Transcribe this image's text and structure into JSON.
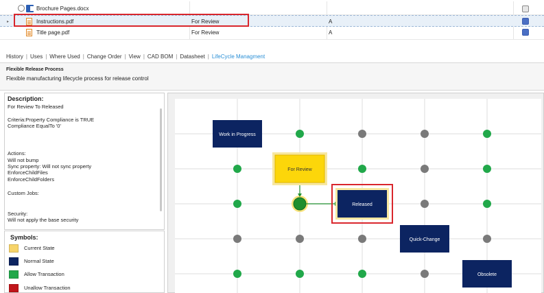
{
  "files": [
    {
      "name": "Brochure Pages.docx",
      "status": "",
      "revision": ""
    },
    {
      "name": "Instructions.pdf",
      "status": "For Review",
      "revision": "A"
    },
    {
      "name": "Title page.pdf",
      "status": "For Review",
      "revision": "A"
    }
  ],
  "tabs": [
    "History",
    "Uses",
    "Where Used",
    "Change Order",
    "View",
    "CAD BOM",
    "Datasheet",
    "LifeCycle Managment"
  ],
  "lifecycle": {
    "title": "Flexible Release Process",
    "description": "Flexible manufacturing lifecycle process for release control"
  },
  "details": {
    "heading": "Description:",
    "lines": [
      "For Review To Released",
      "Criteria:Property Compliance is TRUE",
      "Compliance EqualTo '0'",
      "Actions:",
      "Will not bump",
      "Sync property: Will not sync property",
      "EnforceChildFiles",
      "EnforceChildFolders",
      "Custom Jobs:",
      "Security:",
      "Will not apply the base security"
    ]
  },
  "symbols": {
    "heading": "Symbols:",
    "items": [
      {
        "label": "Current State",
        "color": "#f7d46a"
      },
      {
        "label": "Normal State",
        "color": "#0c2461"
      },
      {
        "label": "Allow Transaction",
        "color": "#21a84a"
      },
      {
        "label": "Unallow Transaction",
        "color": "#c0161b"
      }
    ]
  },
  "states": [
    {
      "label": "Work in Progress",
      "col": 1,
      "row": 1,
      "kind": "normal"
    },
    {
      "label": "For Review",
      "col": 2,
      "row": 2,
      "kind": "current"
    },
    {
      "label": "Released",
      "col": 3,
      "row": 3,
      "kind": "normal-highlight"
    },
    {
      "label": "Quick-Change",
      "col": 4,
      "row": 4,
      "kind": "normal"
    },
    {
      "label": "Obsolete",
      "col": 5,
      "row": 5,
      "kind": "normal"
    }
  ],
  "colors": {
    "normal": "#0c2461",
    "current": "#fcd60a",
    "allow": "#21a84a",
    "gray": "#7a7a7a",
    "highlight": "#d9262c"
  }
}
